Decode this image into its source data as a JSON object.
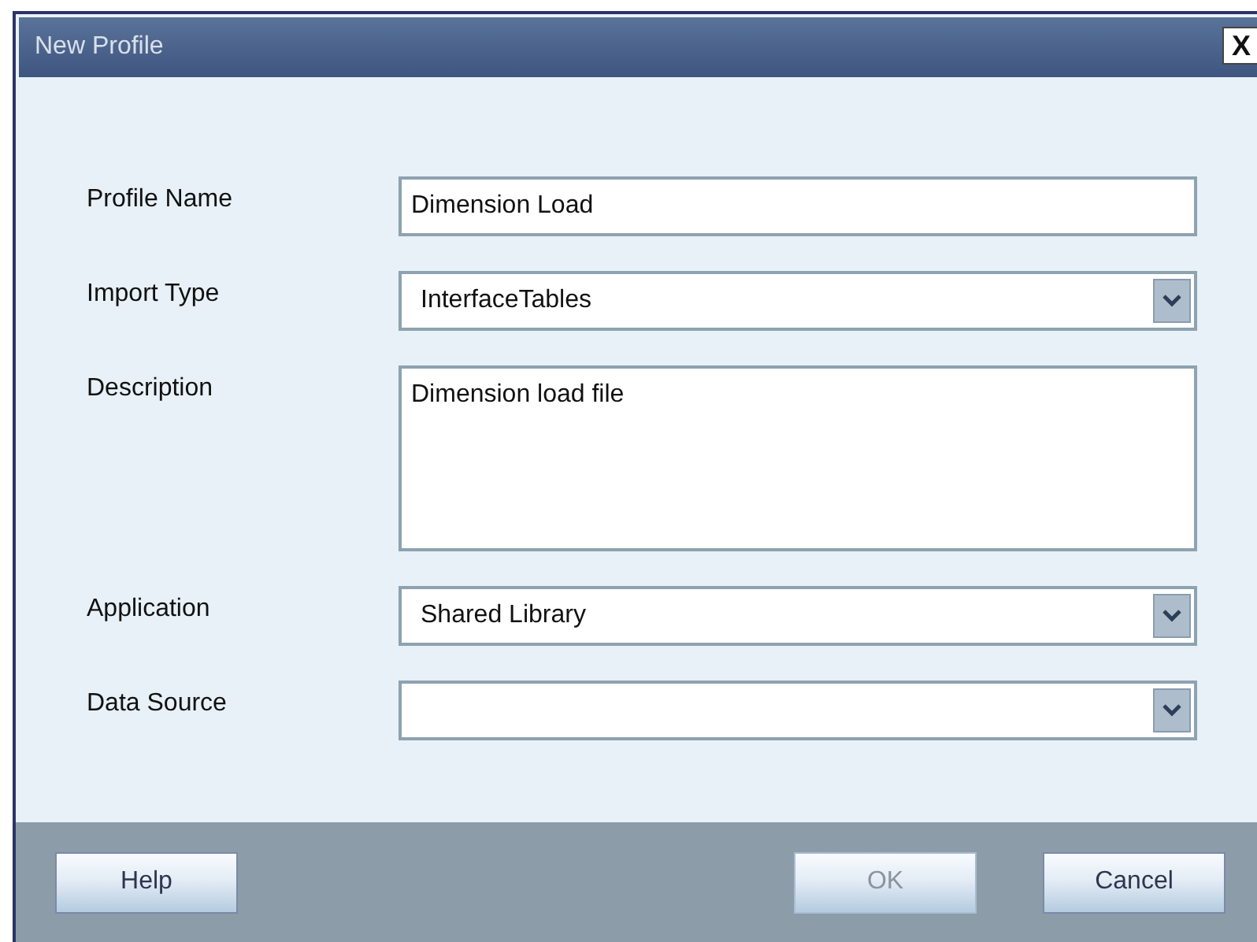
{
  "window": {
    "title": "New Profile",
    "close": "X"
  },
  "fields": [
    {
      "label": "Profile Name",
      "kind": "text",
      "value": "Dimension Load"
    },
    {
      "label": "Import Type",
      "kind": "select",
      "value": "InterfaceTables"
    },
    {
      "label": "Description",
      "kind": "textarea",
      "value": "Dimension load file"
    },
    {
      "label": "Application",
      "kind": "select",
      "value": "Shared Library"
    },
    {
      "label": "Data Source",
      "kind": "select"
    }
  ],
  "footer": {
    "left_buttons": [
      {
        "label": "Help",
        "disabled": false
      }
    ],
    "right_buttons": [
      {
        "label": "OK",
        "disabled": true
      },
      {
        "label": "Cancel",
        "disabled": false
      }
    ]
  }
}
